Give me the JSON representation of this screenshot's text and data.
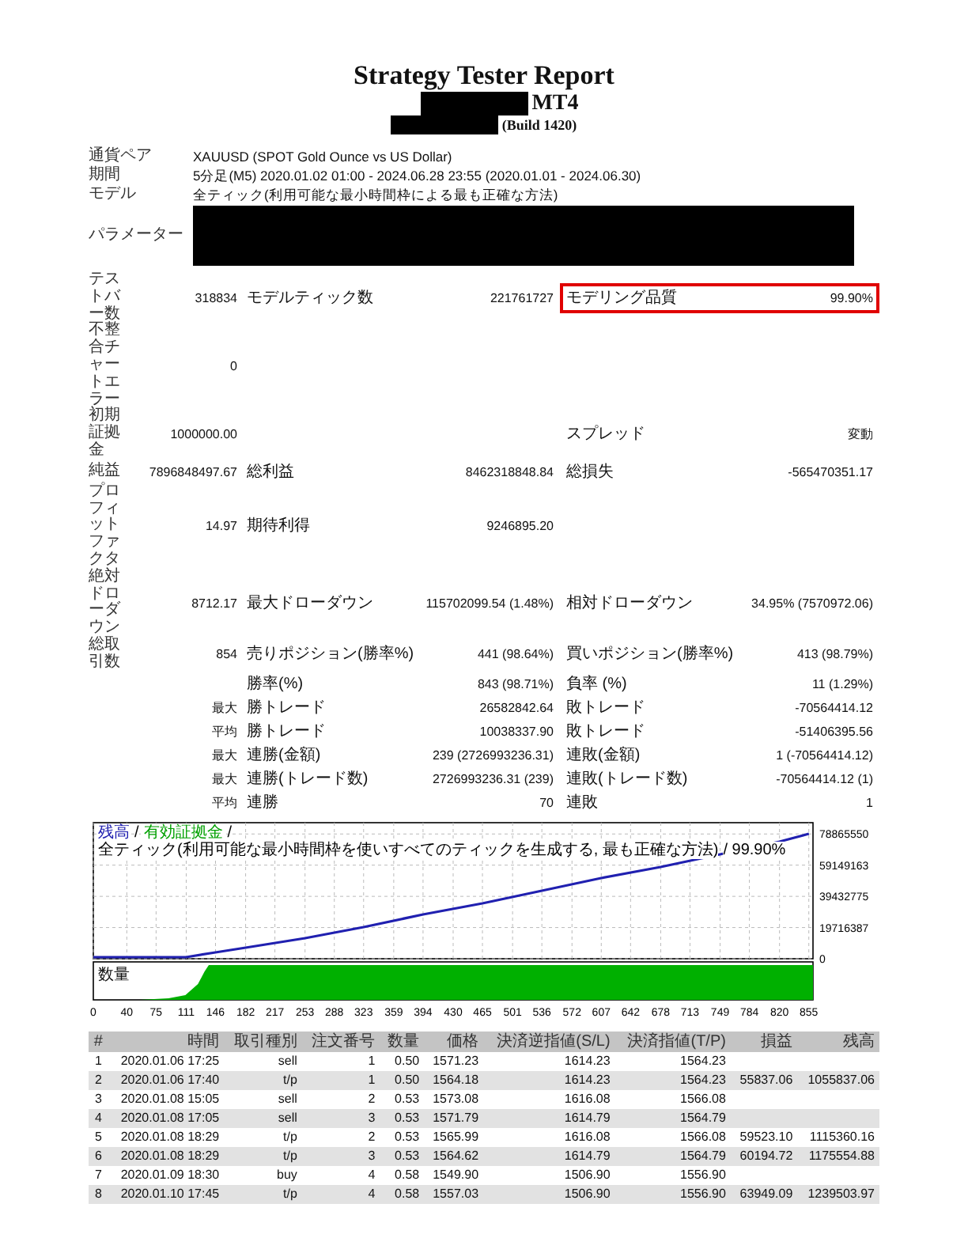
{
  "report": {
    "title": "Strategy Tester Report",
    "product": "MT4",
    "build": "(Build 1420)",
    "redacted": true
  },
  "info": [
    {
      "label": "通貨ペア",
      "value": "XAUUSD (SPOT Gold Ounce vs US Dollar)"
    },
    {
      "label": "期間",
      "value": "5分足(M5) 2020.01.02 01:00 - 2024.06.28 23:55 (2020.01.01 - 2024.06.30)"
    },
    {
      "label": "モデル",
      "value": "全ティック(利用可能な最小時間枠による最も正確な方法)"
    },
    {
      "label": "パラメーター",
      "redacted": true
    }
  ],
  "stats": [
    {
      "label": "テストバー数",
      "value": "318834",
      "pairs": [
        {
          "label": "モデルティック数",
          "value": "221761727"
        },
        {
          "label": "モデリング品質",
          "value": "99.90%",
          "highlighted": true
        }
      ]
    },
    {
      "label": "不整合チャートエラー",
      "value": "0"
    },
    {
      "label": "初期証拠金",
      "value": "1000000.00",
      "middle_empty": true,
      "pairs": [
        {
          "label": "スプレッド",
          "value": "変動"
        }
      ]
    },
    {
      "label": "純益",
      "value": "7896848497.67",
      "pairs": [
        {
          "label": "総利益",
          "value": "8462318848.84"
        },
        {
          "label": "総損失",
          "value": "-565470351.17"
        }
      ]
    },
    {
      "label": "プロフィットファクタ",
      "value": "14.97",
      "pairs": [
        {
          "label": "期待利得",
          "value": "9246895.20"
        }
      ]
    },
    {
      "label": "絶対ドローダウン",
      "value": "8712.17",
      "pairs": [
        {
          "label": "最大ドローダウン",
          "value": "115702099.54 (1.48%)"
        },
        {
          "label": "相対ドローダウン",
          "value": "34.95% (7570972.06)"
        }
      ]
    },
    {
      "label": "総取引数",
      "value": "854",
      "pairs": [
        {
          "label": "売りポジション(勝率%)",
          "value": "441 (98.64%)"
        },
        {
          "label": "買いポジション(勝率%)",
          "value": "413 (98.79%)"
        }
      ]
    },
    {
      "pairs": [
        {
          "label": "勝率(%)",
          "value": "843 (98.71%)"
        },
        {
          "label": "負率 (%)",
          "value": "11 (1.29%)"
        }
      ]
    },
    {
      "value": "最大",
      "pairs": [
        {
          "label": "勝トレード",
          "value": "26582842.64"
        },
        {
          "label": "敗トレード",
          "value": "-70564414.12"
        }
      ]
    },
    {
      "value": "平均",
      "pairs": [
        {
          "label": "勝トレード",
          "value": "10038337.90"
        },
        {
          "label": "敗トレード",
          "value": "-51406395.56"
        }
      ]
    },
    {
      "value": "最大",
      "pairs": [
        {
          "label": "連勝(金額)",
          "value": "239 (2726993236.31)"
        },
        {
          "label": "連敗(金額)",
          "value": "1 (-70564414.12)"
        }
      ]
    },
    {
      "value": "最大",
      "pairs": [
        {
          "label": "連勝(トレード数)",
          "value": "2726993236.31 (239)"
        },
        {
          "label": "連敗(トレード数)",
          "value": "-70564414.12 (1)"
        }
      ]
    },
    {
      "value": "平均",
      "pairs": [
        {
          "label": "連勝",
          "value": "70"
        },
        {
          "label": "連敗",
          "value": "1"
        }
      ]
    }
  ],
  "chart": {
    "legend": [
      {
        "text": "/",
        "color": "#000000"
      },
      {
        "text": "有効証拠金",
        "color": "#00a000"
      },
      {
        "text": "/",
        "color": "#000000"
      },
      {
        "text": "全ティック(利用可能な最小時間枠を使いすべてのティックを生成する, 最も正確な方法)",
        "color": "#000000"
      },
      {
        "text": "/ 99.90%",
        "color": "#000000"
      }
    ],
    "volume_label": "数量",
    "chart_data": {
      "type": "line",
      "x": [
        0,
        111,
        146,
        182,
        253,
        323,
        394,
        465,
        536,
        607,
        678,
        749,
        820,
        855
      ],
      "series": [
        {
          "name": "残高",
          "color": "#2020b0",
          "values": [
            1000000,
            1000000,
            4000000,
            7000000,
            13000000,
            20000000,
            28000000,
            35000000,
            43000000,
            51000000,
            58000000,
            66000000,
            74000000,
            79000000
          ]
        }
      ],
      "grid": true,
      "xlim": [
        0,
        860
      ],
      "ylim": [
        0,
        86000000
      ],
      "xticks": [
        0,
        40,
        75,
        111,
        146,
        182,
        217,
        253,
        288,
        323,
        359,
        394,
        430,
        465,
        501,
        536,
        572,
        607,
        642,
        678,
        713,
        749,
        784,
        820,
        855
      ],
      "yticks": [
        0,
        19716387,
        39432775,
        59149163,
        78865550
      ]
    }
  },
  "trades": {
    "columns": [
      "#",
      "時間",
      "取引種別",
      "注文番号",
      "数量",
      "価格",
      "決済逆指値(S/L)",
      "決済指値(T/P)",
      "損益",
      "残高"
    ],
    "rows": [
      [
        "1",
        "2020.01.06 17:25",
        "sell",
        "1",
        "0.50",
        "1571.23",
        "1614.23",
        "1564.23"
      ],
      [
        "2",
        "2020.01.06 17:40",
        "t/p",
        "1",
        "0.50",
        "1564.18",
        "1614.23",
        "1564.23",
        "55837.06",
        "1055837.06"
      ],
      [
        "3",
        "2020.01.08 15:05",
        "sell",
        "2",
        "0.53",
        "1573.08",
        "1616.08",
        "1566.08"
      ],
      [
        "4",
        "2020.01.08 17:05",
        "sell",
        "3",
        "0.53",
        "1571.79",
        "1614.79",
        "1564.79"
      ],
      [
        "5",
        "2020.01.08 18:29",
        "t/p",
        "2",
        "0.53",
        "1565.99",
        "1616.08",
        "1566.08",
        "59523.10",
        "1115360.16"
      ],
      [
        "6",
        "2020.01.08 18:29",
        "t/p",
        "3",
        "0.53",
        "1564.62",
        "1614.79",
        "1564.79",
        "60194.72",
        "1175554.88"
      ],
      [
        "7",
        "2020.01.09 18:30",
        "buy",
        "4",
        "0.58",
        "1549.90",
        "1506.90",
        "1556.90"
      ],
      [
        "8",
        "2020.01.10 17:45",
        "t/p",
        "4",
        "0.58",
        "1557.03",
        "1506.90",
        "1556.90",
        "63949.09",
        "1239503.97"
      ]
    ]
  }
}
